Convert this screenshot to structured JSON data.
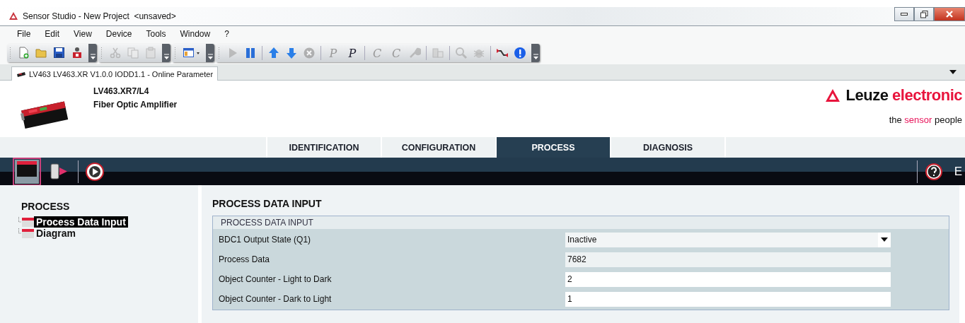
{
  "window": {
    "title": "Sensor Studio - New Project  <unsaved>"
  },
  "menu": [
    "File",
    "Edit",
    "View",
    "Device",
    "Tools",
    "Window",
    "?"
  ],
  "toolbar": [
    [
      {
        "kind": "new",
        "disabled": false
      },
      {
        "kind": "open",
        "disabled": false
      },
      {
        "kind": "save",
        "disabled": false
      },
      {
        "kind": "device",
        "disabled": false
      }
    ],
    [
      {
        "kind": "cut",
        "disabled": true
      },
      {
        "kind": "copy",
        "disabled": true
      },
      {
        "kind": "paste",
        "disabled": true
      }
    ],
    [
      {
        "kind": "layout",
        "disabled": false
      }
    ],
    [
      {
        "kind": "play",
        "disabled": true
      },
      {
        "kind": "pause",
        "disabled": false
      },
      {
        "kind": "sep"
      },
      {
        "kind": "up",
        "disabled": false
      },
      {
        "kind": "down",
        "disabled": false
      },
      {
        "kind": "stop",
        "disabled": true
      },
      {
        "kind": "sep"
      },
      {
        "kind": "letter",
        "label": "P",
        "disabled": true
      },
      {
        "kind": "letter",
        "label": "P",
        "disabled": false
      },
      {
        "kind": "sep"
      },
      {
        "kind": "letter",
        "label": "C",
        "disabled": true
      },
      {
        "kind": "letter",
        "label": "C",
        "disabled": true
      },
      {
        "kind": "wrench",
        "disabled": true
      },
      {
        "kind": "sep"
      },
      {
        "kind": "module",
        "disabled": true
      },
      {
        "kind": "sep"
      },
      {
        "kind": "search",
        "disabled": true
      },
      {
        "kind": "bug",
        "disabled": true
      },
      {
        "kind": "sep"
      },
      {
        "kind": "connect",
        "disabled": false
      },
      {
        "kind": "info",
        "disabled": false
      }
    ]
  ],
  "document_tabs": [
    {
      "label": "LV463 LV463.XR V1.0.0 IODD1.1 - Online Parameter",
      "selected": true
    }
  ],
  "device": {
    "model": "LV463.XR7/L4",
    "description": "Fiber Optic Amplifier"
  },
  "logo": {
    "name": "Leuze",
    "accent": "electronic"
  },
  "tagline": {
    "before": "the",
    "accent": "sensor",
    "after": "people"
  },
  "tabs": [
    {
      "label": "IDENTIFICATION",
      "selected": false
    },
    {
      "label": "CONFIGURATION",
      "selected": false
    },
    {
      "label": "PROCESS",
      "selected": true
    },
    {
      "label": "DIAGNOSIS",
      "selected": false
    }
  ],
  "view_toolbar": {
    "buttons": [
      {
        "kind": "monitor",
        "selected": true
      },
      {
        "kind": "device-play",
        "selected": false
      },
      {
        "kind": "play-circle",
        "selected": false
      }
    ],
    "language": "E"
  },
  "sidebar": {
    "title": "PROCESS",
    "items": [
      {
        "label": "Process Data Input",
        "selected": true
      },
      {
        "label": "Diagram",
        "selected": false
      }
    ]
  },
  "panel": {
    "title": "PROCESS DATA INPUT",
    "group": {
      "title": "PROCESS DATA INPUT",
      "rows": [
        {
          "label": "BDC1 Output State (Q1)",
          "kind": "dropdown",
          "value": "Inactive"
        },
        {
          "label": "Process Data",
          "kind": "readonly",
          "value": "7682"
        },
        {
          "label": "Object Counter - Light to Dark",
          "kind": "input",
          "value": "2"
        },
        {
          "label": "Object Counter - Dark to Light",
          "kind": "input",
          "value": "1"
        }
      ]
    }
  }
}
